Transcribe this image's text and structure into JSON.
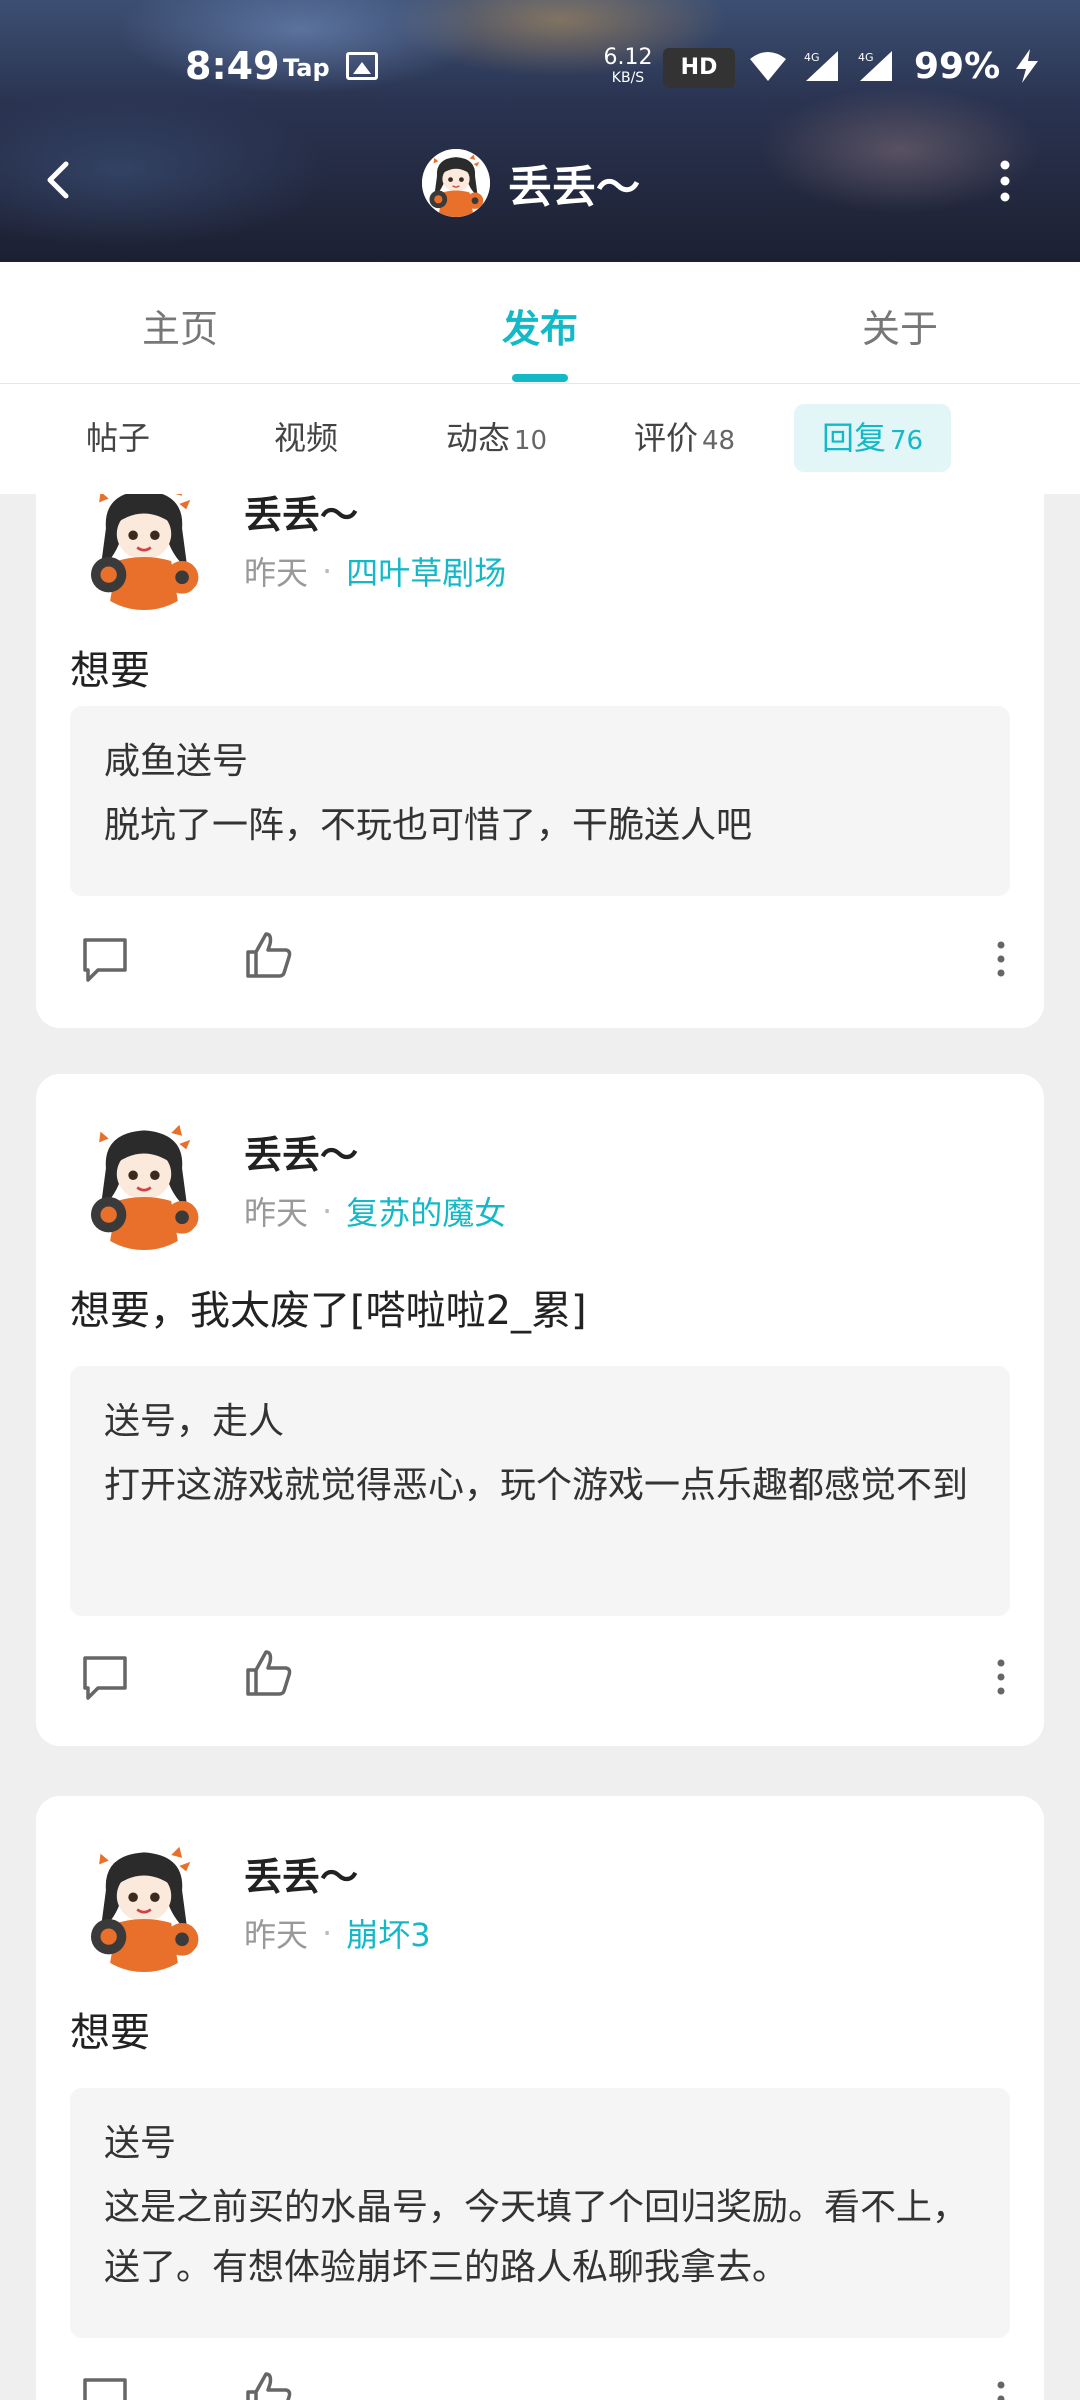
{
  "status_bar": {
    "time": "8:49",
    "tap_label": "Tap",
    "speed_value": "6.12",
    "speed_unit": "KB/S",
    "hd_label": "HD",
    "network_1": "4G",
    "network_2": "4G",
    "battery": "99%"
  },
  "header": {
    "title": "丢丢～"
  },
  "main_tabs": [
    {
      "label": "主页"
    },
    {
      "label": "发布"
    },
    {
      "label": "关于"
    }
  ],
  "sub_tabs": [
    {
      "label": "帖子",
      "count": ""
    },
    {
      "label": "视频",
      "count": ""
    },
    {
      "label": "动态",
      "count": "10"
    },
    {
      "label": "评价",
      "count": "48"
    },
    {
      "label": "回复",
      "count": "76"
    }
  ],
  "posts": [
    {
      "author": "丢丢～",
      "time": "昨天",
      "game": "四叶草剧场",
      "reply": "想要",
      "quote_title": "咸鱼送号",
      "quote_body": "脱坑了一阵，不玩也可惜了，干脆送人吧"
    },
    {
      "author": "丢丢～",
      "time": "昨天",
      "game": "复苏的魔女",
      "reply": "想要，我太废了[嗒啦啦2_累]",
      "quote_title": "送号，走人",
      "quote_body": "打开这游戏就觉得恶心，玩个游戏一点乐趣都感觉不到"
    },
    {
      "author": "丢丢～",
      "time": "昨天",
      "game": "崩坏3",
      "reply": "想要",
      "quote_title": "送号",
      "quote_body": "这是之前买的水晶号，今天填了个回归奖励。看不上，送了。有想体验崩坏三的路人私聊我拿去。"
    }
  ],
  "colors": {
    "accent": "#14b9c8",
    "page_bg": "#efefef"
  }
}
